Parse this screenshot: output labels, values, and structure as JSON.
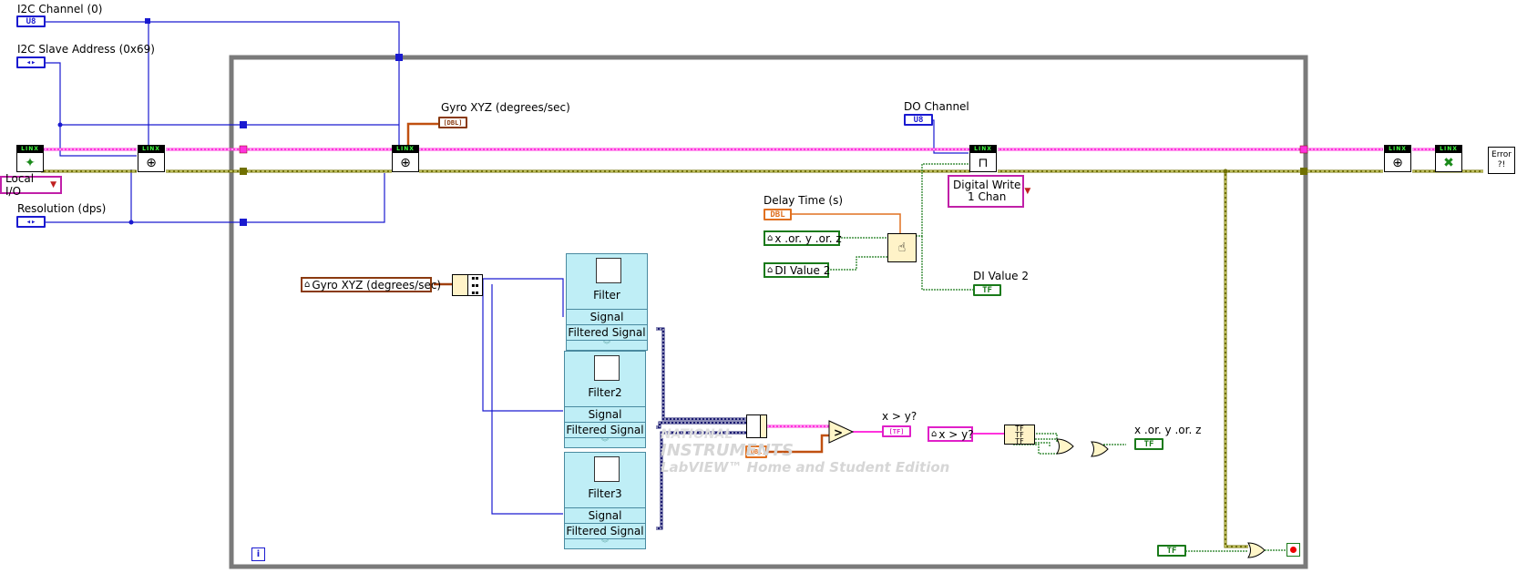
{
  "labels": {
    "i2c_channel": "I2C Channel (0)",
    "i2c_slave": "I2C Slave Address (0x69)",
    "resolution": "Resolution (dps)",
    "gyro_xyz": "Gyro XYZ (degrees/sec)",
    "do_channel": "DO Channel",
    "delay_time": "Delay Time (s)",
    "di_value2": "DI Value 2",
    "xgty": "x > y?",
    "xoryorz": "x .or. y .or. z"
  },
  "terminals": {
    "u8": "U8",
    "u8b": "U8",
    "spin": "◂▸",
    "spinb": "◂▸",
    "dbl": "DBL",
    "tf": "TF",
    "arr": "[DBL]",
    "gyro": "[DBL]",
    "cmp": "[TF]"
  },
  "controls": {
    "local_io": "Local I/O",
    "digital_write": "Digital Write\n1 Chan",
    "gyro_local": "Gyro XYZ (degrees/sec)",
    "local_xoryorz": "x .or. y .or. z",
    "local_di": "DI Value 2",
    "local_xgty": "x > y?",
    "home": "⌂"
  },
  "filters": [
    {
      "name": "Filter",
      "signal": "Signal",
      "filtered": "Filtered Signal"
    },
    {
      "name": "Filter2",
      "signal": "Signal",
      "filtered": "Filtered Signal"
    },
    {
      "name": "Filter3",
      "signal": "Signal",
      "filtered": "Filtered Signal"
    }
  ],
  "linx": {
    "bar": "LINX"
  },
  "error_handler": "Error\n?!",
  "watermark": {
    "line1": "NATIONAL",
    "line2": "INSTRUMENTS",
    "line3": "LabVIEW™ Home and Student Edition"
  },
  "loop_iteration": "i",
  "gates": {
    "or": "V",
    "gt": ">"
  },
  "colors": {
    "error_wire": "#ff33dd",
    "resource_wire": "#808000",
    "int_wire": "#1a1ad0",
    "bool_wire": "#1a7a1a",
    "dbl_wire": "#e07020",
    "loop": "#7a7a7a"
  }
}
